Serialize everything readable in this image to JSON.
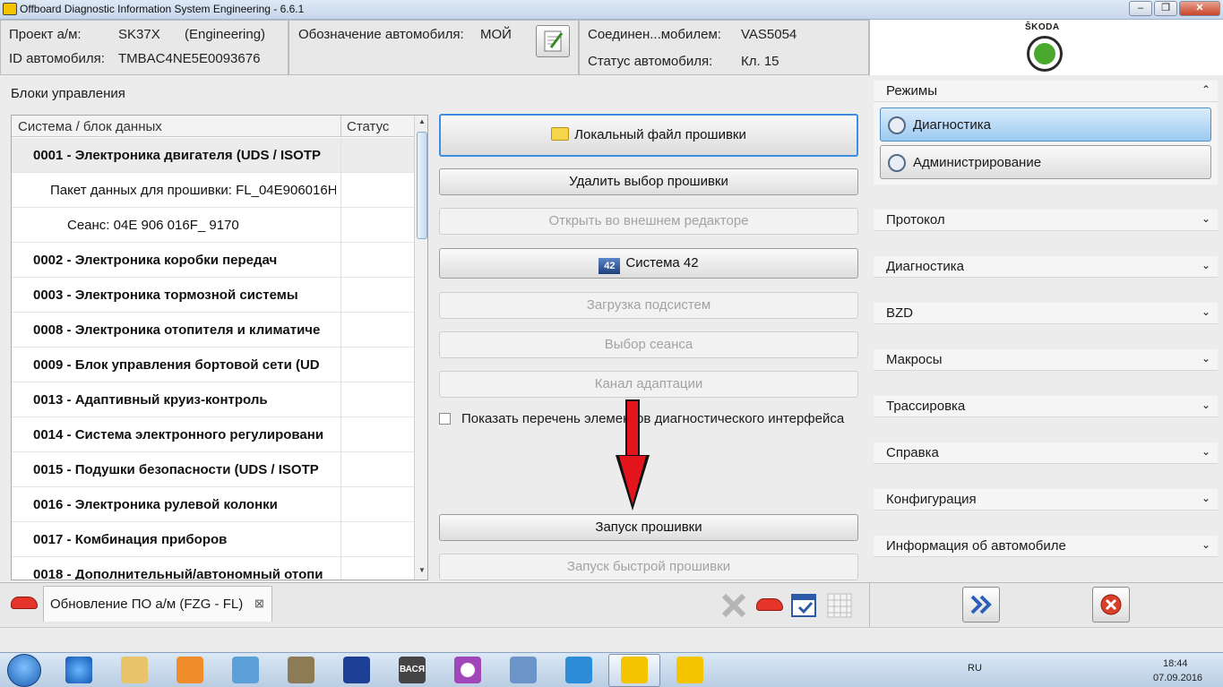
{
  "window": {
    "title": "Offboard Diagnostic Information System Engineering - 6.6.1",
    "minimize": "–",
    "maximize": "❐",
    "close": "✕"
  },
  "header": {
    "project_label": "Проект а/м:",
    "project_value": "SK37X",
    "project_mode": "(Engineering)",
    "vin_label": "ID автомобиля:",
    "vin_value": "TMBAC4NE5E0093676",
    "designation_label": "Обозначение автомобиля:",
    "designation_value": "МОЙ",
    "connection_label": "Соединен...мобилем:",
    "connection_value": "VAS5054",
    "status_label": "Статус автомобиля:",
    "status_value": "Кл. 15",
    "logo_text": "ŠKODA"
  },
  "left_panel": {
    "title": "Блоки управления",
    "col_system": "Система / блок данных",
    "col_status": "Статус",
    "rows": [
      {
        "text": "0001 - Электроника двигателя  (UDS / ISOTP",
        "bold": true,
        "selected": true
      },
      {
        "text": "Пакет данных для прошивки: FL_04E906016H",
        "bold": false
      },
      {
        "text": "Сеанс: 04E 906 016F_ 9170",
        "bold": false
      },
      {
        "text": "0002 - Электроника коробки передач",
        "bold": true
      },
      {
        "text": "0003 - Электроника тормозной системы",
        "bold": true
      },
      {
        "text": "0008 - Электроника отопителя и климатиче",
        "bold": true
      },
      {
        "text": "0009 - Блок управления бортовой сети  (UD",
        "bold": true
      },
      {
        "text": "0013 - Адаптивный круиз-контроль",
        "bold": true
      },
      {
        "text": "0014 - Система электронного регулировани",
        "bold": true
      },
      {
        "text": "0015 - Подушки безопасности  (UDS / ISOTP",
        "bold": true
      },
      {
        "text": "0016 - Электроника рулевой колонки",
        "bold": true
      },
      {
        "text": "0017 - Комбинация приборов",
        "bold": true
      },
      {
        "text": "0018 - Дополнительный/автономный отопи",
        "bold": true
      }
    ]
  },
  "actions": {
    "local_file": "Локальный файл прошивки",
    "delete_selection": "Удалить выбор прошивки",
    "open_external": "Открыть во внешнем редакторе",
    "system42": "Система 42",
    "system42_badge": "42",
    "load_subsystems": "Загрузка подсистем",
    "select_session": "Выбор сеанса",
    "adaptation_channel": "Канал адаптации",
    "show_list": "Показать перечень элементов диагностического интерфейса",
    "start_flash": "Запуск прошивки",
    "start_quick_flash": "Запуск быстрой прошивки"
  },
  "right_panel": {
    "modes_title": "Режимы",
    "mode_diagnostics": "Диагностика",
    "mode_admin": "Администрирование",
    "sections": [
      "Протокол",
      "Диагностика",
      "BZD",
      "Макросы",
      "Трассировка",
      "Справка",
      "Конфигурация",
      "Информация об автомобиле"
    ]
  },
  "bottom": {
    "tab_label": "Обновление ПО а/м (FZG - FL)",
    "tab_close": "⊠"
  },
  "taskbar": {
    "lang": "RU",
    "time": "18:44",
    "date": "07.09.2016",
    "app_label": "ВАСЯ"
  },
  "colors": {
    "accent_blue": "#3d8ee0",
    "arrow_red": "#e3141b",
    "skoda_green": "#4ba82e",
    "close_red": "#d8402a"
  }
}
